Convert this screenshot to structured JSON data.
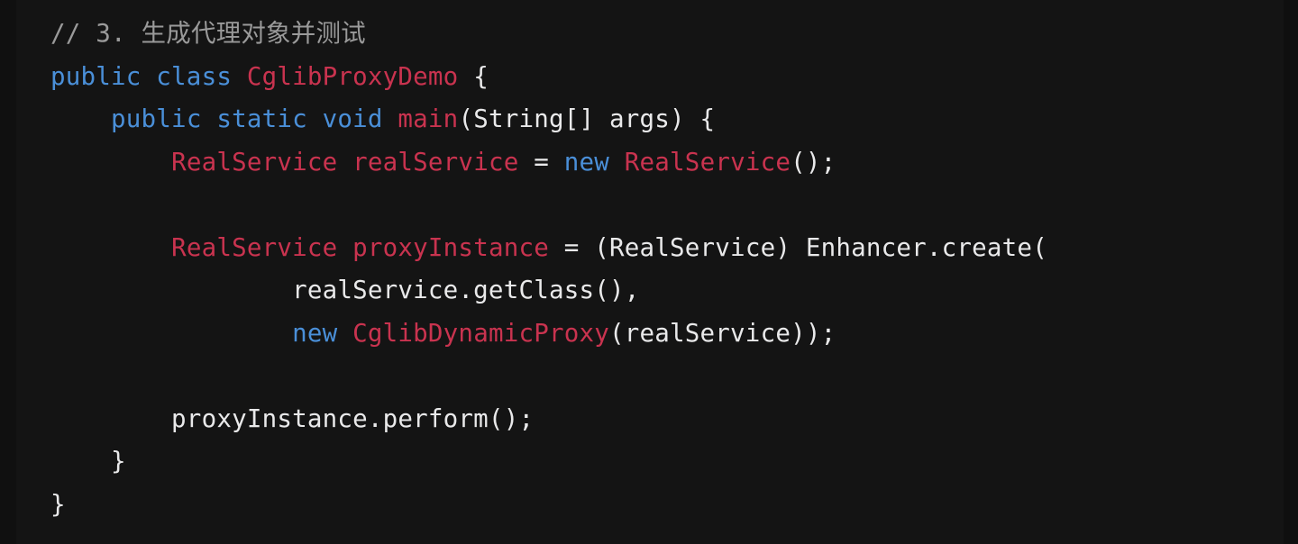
{
  "editor": {
    "lines": [
      [
        {
          "t": "// 3. 生成代理对象并测试",
          "k": "cm"
        }
      ],
      [
        {
          "t": "public class ",
          "k": "kw"
        },
        {
          "t": "CglibProxyDemo",
          "k": "ty"
        },
        {
          "t": " {",
          "k": "pl"
        }
      ],
      [
        {
          "t": "    ",
          "k": "pl"
        },
        {
          "t": "public static void ",
          "k": "kw"
        },
        {
          "t": "main",
          "k": "ty"
        },
        {
          "t": "(String[] args) {",
          "k": "pl"
        }
      ],
      [
        {
          "t": "        ",
          "k": "pl"
        },
        {
          "t": "RealService realService",
          "k": "ty"
        },
        {
          "t": " = ",
          "k": "pl"
        },
        {
          "t": "new ",
          "k": "kw"
        },
        {
          "t": "RealService",
          "k": "ty"
        },
        {
          "t": "();",
          "k": "pl"
        }
      ],
      [
        {
          "t": "",
          "k": "pl"
        }
      ],
      [
        {
          "t": "        ",
          "k": "pl"
        },
        {
          "t": "RealService proxyInstance",
          "k": "ty"
        },
        {
          "t": " = (RealService) Enhancer.create(",
          "k": "pl"
        }
      ],
      [
        {
          "t": "                realService.getClass(),",
          "k": "pl"
        }
      ],
      [
        {
          "t": "                ",
          "k": "pl"
        },
        {
          "t": "new ",
          "k": "kw"
        },
        {
          "t": "CglibDynamicProxy",
          "k": "ty"
        },
        {
          "t": "(realService));",
          "k": "pl"
        }
      ],
      [
        {
          "t": "",
          "k": "pl"
        }
      ],
      [
        {
          "t": "        proxyInstance.perform();",
          "k": "pl"
        }
      ],
      [
        {
          "t": "    }",
          "k": "pl"
        }
      ],
      [
        {
          "t": "}",
          "k": "pl"
        }
      ]
    ]
  },
  "colors": {
    "background": "#141414",
    "keyword": "#4a8fd8",
    "type": "#c9334f",
    "comment": "#9a9a9a",
    "plain": "#e9e9ea"
  }
}
